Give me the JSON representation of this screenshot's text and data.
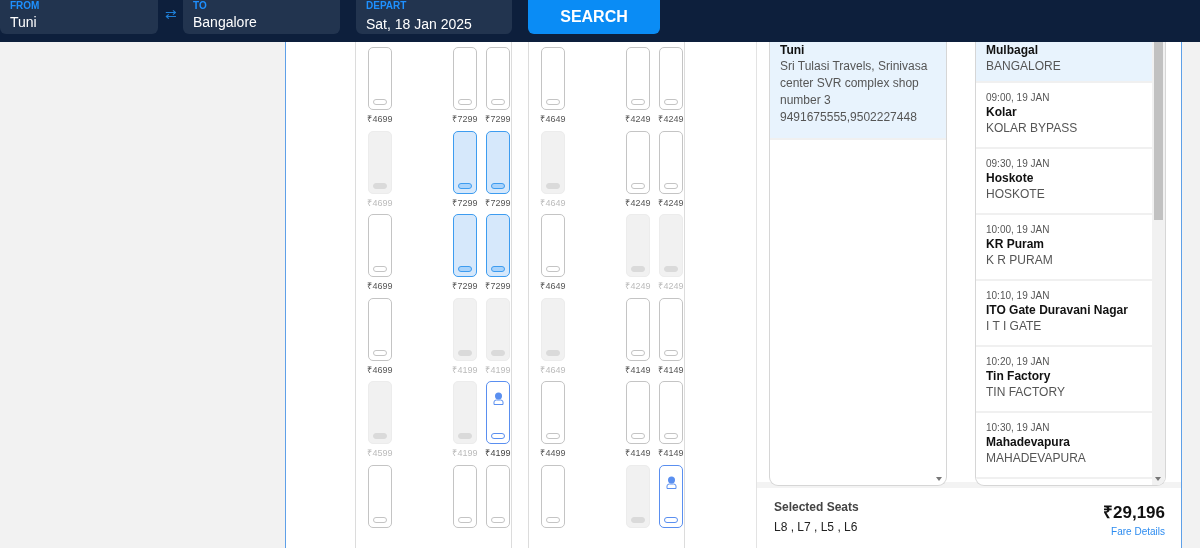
{
  "search_bar": {
    "from": {
      "label": "FROM",
      "value": "Tuni"
    },
    "swap": "⇄",
    "to": {
      "label": "TO",
      "value": "Bangalore"
    },
    "depart": {
      "label": "DEPART",
      "value": "Sat, 18 Jan 2025"
    },
    "button": "SEARCH"
  },
  "decks": [
    {
      "rows": [
        [
          {
            "kind": "available",
            "price": "₹4699"
          },
          {
            "kind": "available",
            "price": "₹7299"
          },
          {
            "kind": "available",
            "price": "₹7299"
          }
        ],
        [
          {
            "kind": "booked",
            "price": "₹4699"
          },
          {
            "kind": "selected",
            "price": "₹7299"
          },
          {
            "kind": "selected",
            "price": "₹7299"
          }
        ],
        [
          {
            "kind": "available",
            "price": "₹4699"
          },
          {
            "kind": "selected",
            "price": "₹7299"
          },
          {
            "kind": "selected",
            "price": "₹7299"
          }
        ],
        [
          {
            "kind": "available",
            "price": "₹4699"
          },
          {
            "kind": "booked",
            "price": "₹4199"
          },
          {
            "kind": "booked",
            "price": "₹4199"
          }
        ],
        [
          {
            "kind": "booked",
            "price": "₹4599"
          },
          {
            "kind": "booked",
            "price": "₹4199"
          },
          {
            "kind": "ladies",
            "price": "₹4199"
          }
        ],
        [
          {
            "kind": "available"
          },
          {
            "kind": "available"
          },
          {
            "kind": "available"
          }
        ]
      ]
    },
    {
      "rows": [
        [
          {
            "kind": "available",
            "price": "₹4649"
          },
          {
            "kind": "available",
            "price": "₹4249"
          },
          {
            "kind": "available",
            "price": "₹4249"
          }
        ],
        [
          {
            "kind": "booked",
            "price": "₹4649"
          },
          {
            "kind": "available",
            "price": "₹4249"
          },
          {
            "kind": "available",
            "price": "₹4249"
          }
        ],
        [
          {
            "kind": "available",
            "price": "₹4649"
          },
          {
            "kind": "booked",
            "price": "₹4249"
          },
          {
            "kind": "booked",
            "price": "₹4249"
          }
        ],
        [
          {
            "kind": "booked",
            "price": "₹4649"
          },
          {
            "kind": "available",
            "price": "₹4149"
          },
          {
            "kind": "available",
            "price": "₹4149"
          }
        ],
        [
          {
            "kind": "available",
            "price": "₹4499"
          },
          {
            "kind": "available",
            "price": "₹4149"
          },
          {
            "kind": "available",
            "price": "₹4149"
          }
        ],
        [
          {
            "kind": "available"
          },
          {
            "kind": "booked"
          },
          {
            "kind": "ladies"
          }
        ]
      ]
    }
  ],
  "boarding_points": [
    {
      "name": "Tuni",
      "address": "Sri Tulasi Travels, Srinivasa center SVR complex shop number 3 9491675555,9502227448",
      "selected": true
    }
  ],
  "dropping_points": [
    {
      "name": "Mulbagal",
      "place": "BANGALORE",
      "selected": true
    },
    {
      "time": "09:00, 19 JAN",
      "name": "Kolar",
      "place": "KOLAR BYPASS",
      "selected": false
    },
    {
      "time": "09:30, 19 JAN",
      "name": "Hoskote",
      "place": "HOSKOTE",
      "selected": false
    },
    {
      "time": "10:00, 19 JAN",
      "name": "KR Puram",
      "place": "K R PURAM",
      "selected": false
    },
    {
      "time": "10:10, 19 JAN",
      "name": "ITO Gate Duravani Nagar",
      "place": "I T I GATE",
      "selected": false
    },
    {
      "time": "10:20, 19 JAN",
      "name": "Tin Factory",
      "place": "TIN FACTORY",
      "selected": false
    },
    {
      "time": "10:30, 19 JAN",
      "name": "Mahadevapura",
      "place": "MAHADEVAPURA",
      "selected": false
    }
  ],
  "summary": {
    "label": "Selected Seats",
    "seats": "L8 , L7 , L5 , L6",
    "total": "₹29,196",
    "link": "Fare Details"
  }
}
